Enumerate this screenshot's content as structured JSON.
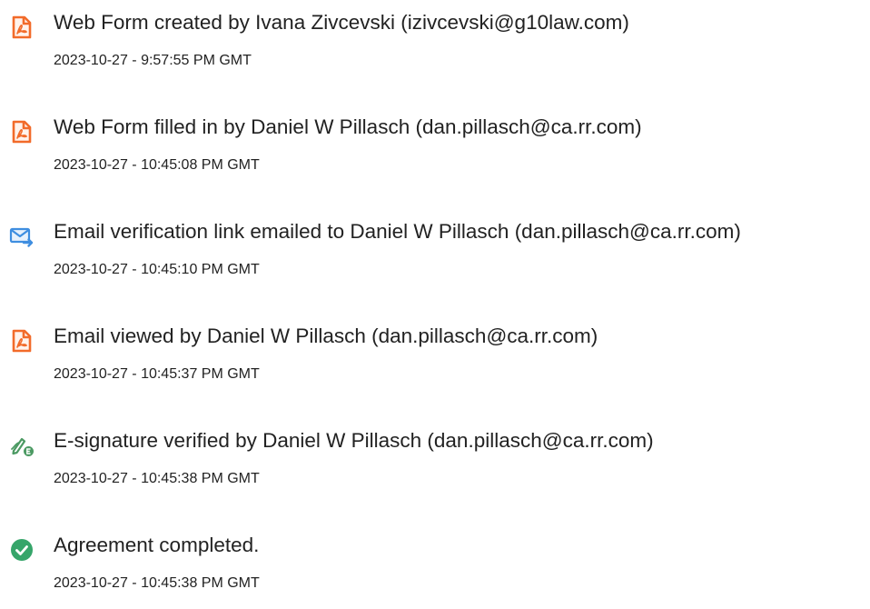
{
  "events": [
    {
      "icon": "pdf-document-icon",
      "title": "Web Form created by Ivana Zivcevski (izivcevski@g10law.com)",
      "timestamp": "2023-10-27 - 9:57:55 PM GMT"
    },
    {
      "icon": "pdf-document-icon",
      "title": "Web Form filled in by Daniel W Pillasch (dan.pillasch@ca.rr.com)",
      "timestamp": "2023-10-27 - 10:45:08 PM GMT"
    },
    {
      "icon": "email-send-icon",
      "title": "Email verification link emailed to Daniel W Pillasch (dan.pillasch@ca.rr.com)",
      "timestamp": "2023-10-27 - 10:45:10 PM GMT"
    },
    {
      "icon": "pdf-document-icon",
      "title": "Email viewed by Daniel W Pillasch (dan.pillasch@ca.rr.com)",
      "timestamp": "2023-10-27 - 10:45:37 PM GMT"
    },
    {
      "icon": "e-signature-icon",
      "title": "E-signature verified by Daniel W Pillasch (dan.pillasch@ca.rr.com)",
      "timestamp": "2023-10-27 - 10:45:38 PM GMT"
    },
    {
      "icon": "check-circle-icon",
      "title": "Agreement completed.",
      "timestamp": "2023-10-27 - 10:45:38 PM GMT"
    }
  ],
  "colors": {
    "pdf_icon": "#f26b2a",
    "email_icon": "#3f8ee0",
    "signature_icon": "#4c9a63",
    "check_icon": "#36a56a"
  }
}
